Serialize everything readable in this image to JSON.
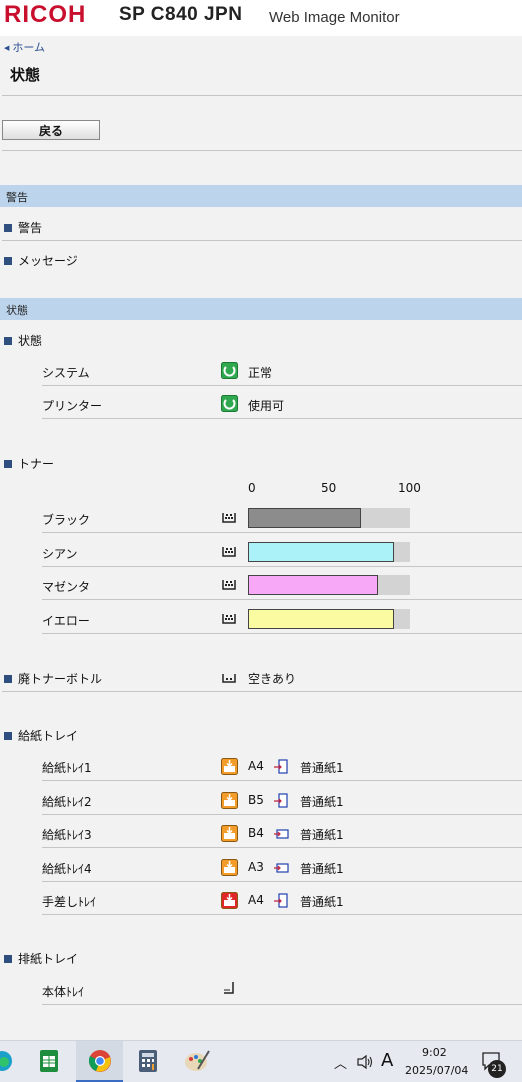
{
  "header": {
    "brand": "RICOH",
    "model": "SP C840 JPN",
    "app_name": "Web Image Monitor"
  },
  "breadcrumb": {
    "home": "ホーム"
  },
  "page": {
    "title": "状態",
    "back_button": "戻る"
  },
  "alerts_section": {
    "header": "警告",
    "items": [
      {
        "label": "警告"
      },
      {
        "label": "メッセージ"
      }
    ]
  },
  "status_section": {
    "header": "状態",
    "status_group": {
      "label": "状態",
      "rows": [
        {
          "label": "システム",
          "value": "正常",
          "icon": "status-ok-icon"
        },
        {
          "label": "プリンター",
          "value": "使用可",
          "icon": "status-ok-icon"
        }
      ]
    },
    "toner": {
      "label": "トナー",
      "scale": [
        "0",
        "50",
        "100"
      ],
      "rows": [
        {
          "label": "ブラック",
          "level": 70,
          "color": "#8c8c8c"
        },
        {
          "label": "シアン",
          "level": 90,
          "color": "#aaf2f8"
        },
        {
          "label": "マゼンタ",
          "level": 80,
          "color": "#f7a9f7"
        },
        {
          "label": "イエロー",
          "level": 90,
          "color": "#fbfba2"
        }
      ]
    },
    "waste_toner": {
      "label": "廃トナーボトル",
      "value": "空きあり"
    },
    "paper_trays": {
      "label": "給紙トレイ",
      "rows": [
        {
          "label": "給紙ﾄﾚｲ1",
          "size": "A4",
          "paper": "普通紙1",
          "icon": "tray-icon",
          "orientation": "portrait"
        },
        {
          "label": "給紙ﾄﾚｲ2",
          "size": "B5",
          "paper": "普通紙1",
          "icon": "tray-icon",
          "orientation": "portrait"
        },
        {
          "label": "給紙ﾄﾚｲ3",
          "size": "B4",
          "paper": "普通紙1",
          "icon": "tray-icon",
          "orientation": "landscape"
        },
        {
          "label": "給紙ﾄﾚｲ4",
          "size": "A3",
          "paper": "普通紙1",
          "icon": "tray-icon",
          "orientation": "landscape"
        },
        {
          "label": "手差しﾄﾚｲ",
          "size": "A4",
          "paper": "普通紙1",
          "icon": "bypass-tray-icon",
          "orientation": "portrait"
        }
      ]
    },
    "output_trays": {
      "label": "排紙トレイ",
      "rows": [
        {
          "label": "本体ﾄﾚｲ"
        }
      ]
    }
  },
  "taskbar": {
    "time": "9:02",
    "date": "2025/07/04",
    "ime": "A",
    "notifications": "21",
    "apps": [
      "edge-icon",
      "sheets-icon",
      "chrome-icon",
      "calculator-icon",
      "paint-icon"
    ]
  }
}
